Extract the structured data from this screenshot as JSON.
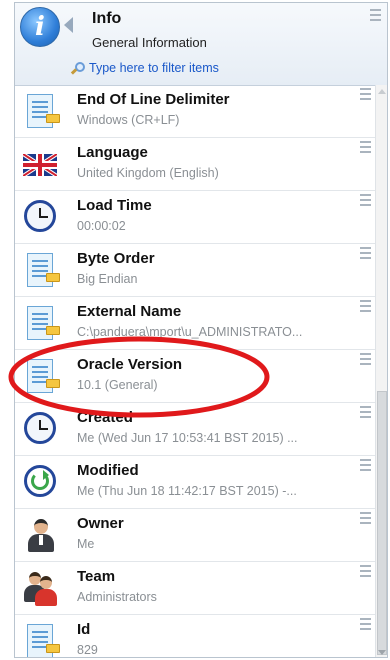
{
  "header": {
    "title": "Info",
    "subtitle": "General Information",
    "filter_placeholder": "Type here to filter items"
  },
  "items": [
    {
      "name": "End Of Line Delimiter",
      "value": "Windows (CR+LF)",
      "icon": "document-icon"
    },
    {
      "name": "Language",
      "value": "United Kingdom (English)",
      "icon": "uk-flag-icon"
    },
    {
      "name": "Load Time",
      "value": "00:00:02",
      "icon": "clock-icon"
    },
    {
      "name": "Byte Order",
      "value": "Big Endian",
      "icon": "document-icon"
    },
    {
      "name": "External Name",
      "value": "C:\\panduera\\mport\\u_ADMINISTRATO...",
      "icon": "document-icon"
    },
    {
      "name": "Oracle Version",
      "value": "10.1 (General)",
      "icon": "document-icon"
    },
    {
      "name": "Created",
      "value": "Me (Wed Jun 17 10:53:41 BST 2015) ...",
      "icon": "clock-icon"
    },
    {
      "name": "Modified",
      "value": "Me (Thu Jun 18 11:42:17 BST 2015) -...",
      "icon": "modified-icon"
    },
    {
      "name": "Owner",
      "value": "Me",
      "icon": "user-icon"
    },
    {
      "name": "Team",
      "value": "Administrators",
      "icon": "team-icon"
    },
    {
      "name": "Id",
      "value": "829",
      "icon": "document-icon"
    }
  ],
  "colors": {
    "highlight_ellipse": "#e0191b",
    "filter_link": "#1a58c9"
  }
}
